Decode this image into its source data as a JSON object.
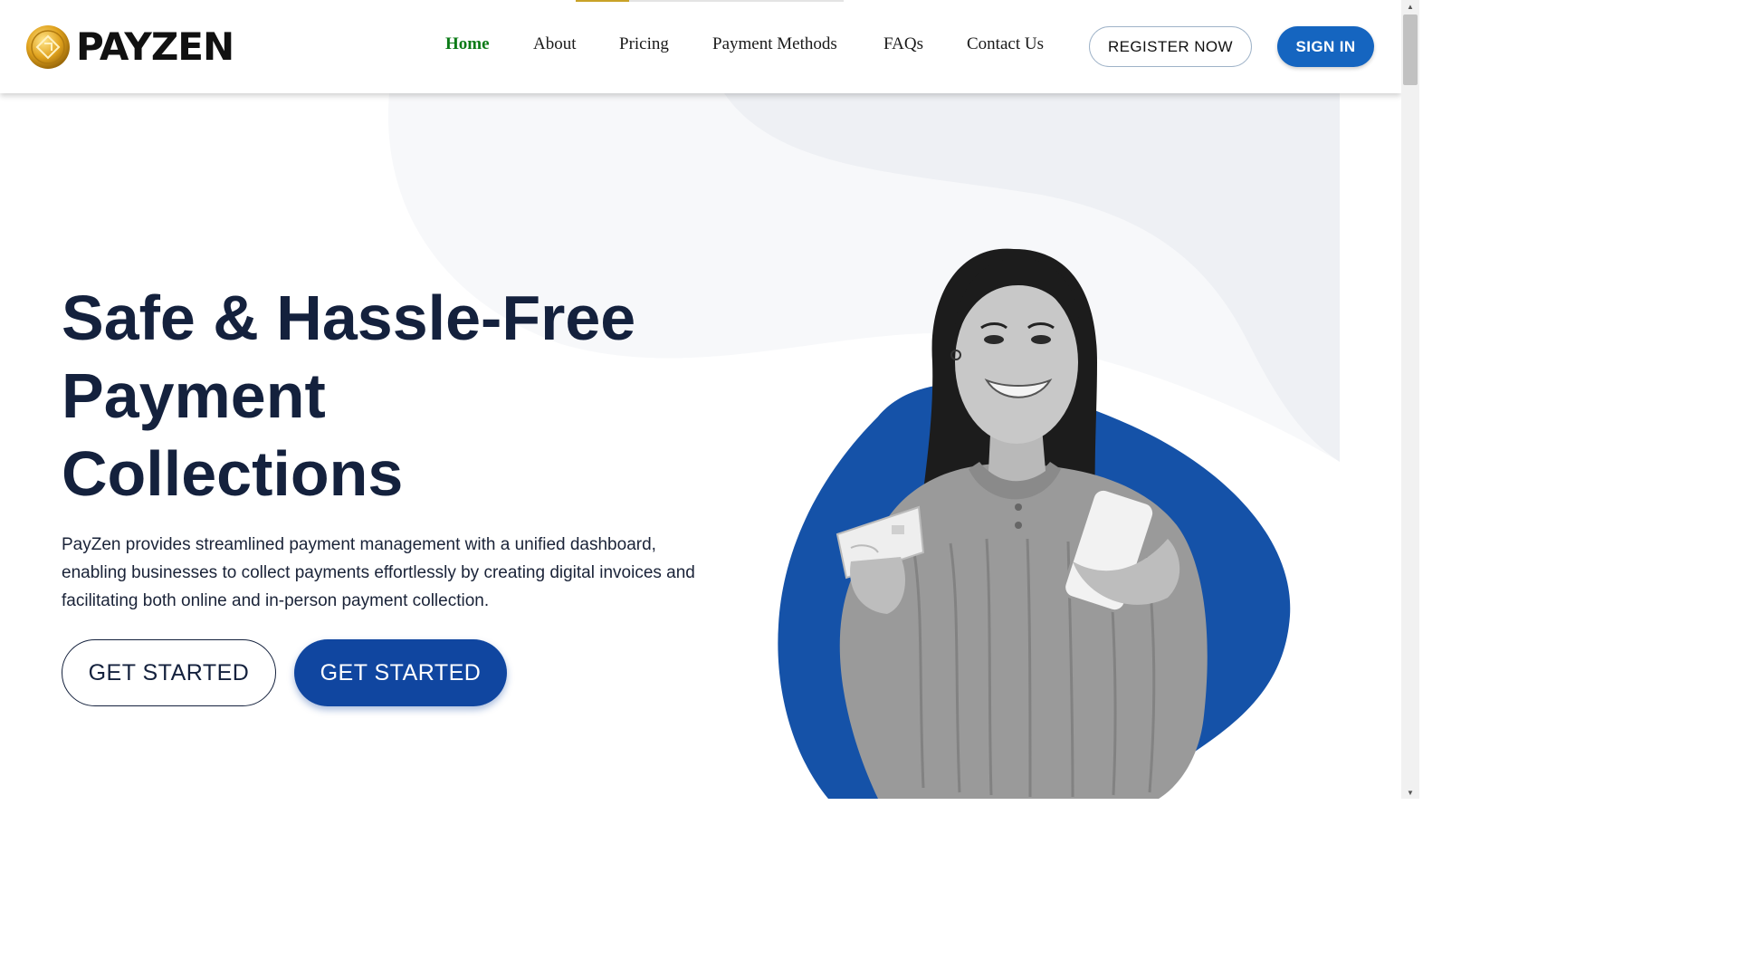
{
  "brand": {
    "name": "PAYZEN"
  },
  "nav": {
    "items": [
      {
        "label": "Home",
        "active": true
      },
      {
        "label": "About",
        "active": false
      },
      {
        "label": "Pricing",
        "active": false
      },
      {
        "label": "Payment Methods",
        "active": false
      },
      {
        "label": "FAQs",
        "active": false
      },
      {
        "label": "Contact Us",
        "active": false
      }
    ],
    "register_label": "REGISTER NOW",
    "signin_label": "SIGN IN"
  },
  "hero": {
    "title_line1": "Safe & Hassle-Free",
    "title_line2": "Payment",
    "title_line3": "Collections",
    "description": "PayZen provides streamlined payment management with a unified dashboard, enabling businesses to collect payments effortlessly by creating digital invoices and facilitating both online and in-person payment collection.",
    "cta_outline_label": "GET STARTED",
    "cta_filled_label": "GET STARTED"
  },
  "colors": {
    "accent_blue": "#1565c0",
    "hero_blob": "#1552a8",
    "title_navy": "#14213d",
    "active_nav": "#0b7a16",
    "gold": "#c9a227"
  },
  "icons": {
    "logo": "gold-coin-logo-icon",
    "scroll_up": "triangle-up-icon",
    "scroll_down": "triangle-down-icon"
  }
}
